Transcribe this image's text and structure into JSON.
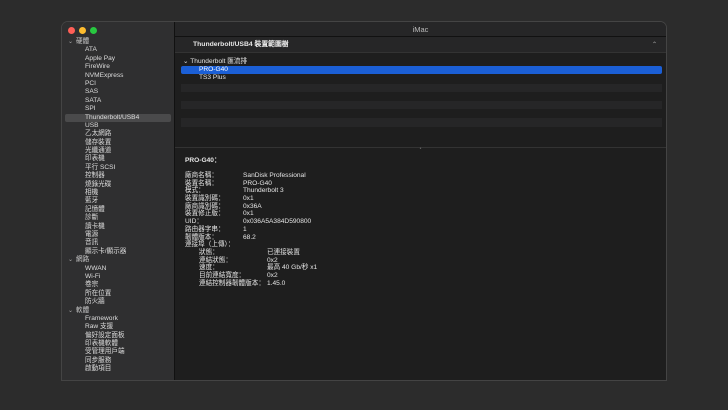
{
  "window": {
    "title": "iMac",
    "traffic_lights": {
      "close": "#ff5f57",
      "minimize": "#febc2e",
      "zoom": "#28c840"
    }
  },
  "sidebar": {
    "groups": [
      {
        "label": "硬體",
        "items": [
          "ATA",
          "Apple Pay",
          "FireWire",
          "NVMExpress",
          "PCI",
          "SAS",
          "SATA",
          "SPI",
          "Thunderbolt/USB4",
          "USB",
          "乙太網路",
          "儲存裝置",
          "光纖通道",
          "印表機",
          "平行 SCSI",
          "控制器",
          "燒錄光碟",
          "相機",
          "藍牙",
          "記憶體",
          "診斷",
          "讀卡機",
          "電源",
          "音訊",
          "顯示卡/顯示器"
        ]
      },
      {
        "label": "網路",
        "items": [
          "WWAN",
          "Wi-Fi",
          "卷宗",
          "所在位置",
          "防火牆"
        ]
      },
      {
        "label": "軟體",
        "items": [
          "Framework",
          "Raw 支援",
          "偏好設定面板",
          "印表機軟體",
          "受管理用戶端",
          "同步服務",
          "啟動項目"
        ]
      }
    ],
    "selected": "Thunderbolt/USB4"
  },
  "main": {
    "header": "Thunderbolt/USB4 裝置範圍樹",
    "tree": {
      "root": "Thunderbolt 匯流排",
      "children": [
        "PRO-G40",
        "TS3 Plus"
      ],
      "selected": "PRO-G40"
    },
    "detail": {
      "title": "PRO-G40：",
      "rows": [
        {
          "k": "廠商名稱：",
          "v": "SanDisk Professional"
        },
        {
          "k": "裝置名稱：",
          "v": "PRO-G40"
        },
        {
          "k": "模式：",
          "v": "Thunderbolt 3"
        },
        {
          "k": "裝置識別碼：",
          "v": "0x1"
        },
        {
          "k": "廠商識別碼：",
          "v": "0x36A"
        },
        {
          "k": "裝置修正版：",
          "v": "0x1"
        },
        {
          "k": "UID：",
          "v": "0x036A5A384D590800"
        },
        {
          "k": "路由器字串：",
          "v": "1"
        },
        {
          "k": "韌體版本：",
          "v": "68.2"
        },
        {
          "k": "連接埠（上傳）：",
          "v": ""
        }
      ],
      "port_rows": [
        {
          "k": "狀態：",
          "v": "已連接裝置"
        },
        {
          "k": "連結狀態：",
          "v": "0x2"
        },
        {
          "k": "速度：",
          "v": "最高 40 Gb/秒 x1"
        },
        {
          "k": "目前連結寬度：",
          "v": "0x2"
        },
        {
          "k": "連結控制器韌體版本：",
          "v": "1.45.0"
        }
      ]
    }
  }
}
